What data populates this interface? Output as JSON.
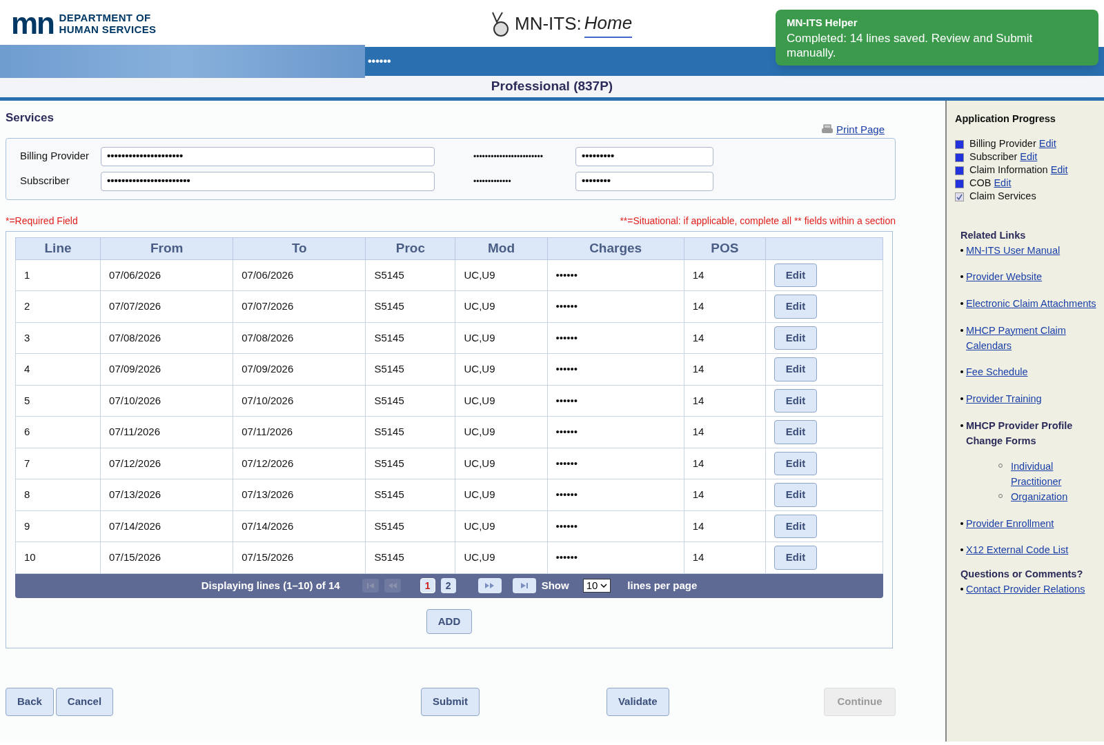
{
  "header": {
    "logo_mark": "mn",
    "logo_lines": [
      "DEPARTMENT OF",
      "HUMAN SERVICES"
    ],
    "app_title": "MN-ITS:",
    "app_subtitle": "Home",
    "masked_user": "••••••"
  },
  "toast": {
    "title": "MN-ITS Helper",
    "message": "Completed: 14 lines saved. Review and Submit manually."
  },
  "page_title": "Professional (837P)",
  "section_title": "Services",
  "print_link": "Print Page",
  "summary": [
    {
      "label": "Billing Provider",
      "value": "•••••••••••••••••••••",
      "label_2": "••••••••••••••••••••••••",
      "value_2": "•••••••••"
    },
    {
      "label": "Subscriber",
      "value": "•••••••••••••••••••••••",
      "label_2": "•••••••••••••",
      "value_2": "••••••••"
    }
  ],
  "required_note": "*=Required Field",
  "situational_note": "**=Situational: if applicable, complete all ** fields within a section",
  "table": {
    "columns": [
      "Line",
      "From",
      "To",
      "Proc",
      "Mod",
      "Charges",
      "POS"
    ],
    "rows": [
      {
        "cells": [
          "1",
          "07/06/2026",
          "07/06/2026",
          "S5145",
          "UC,U9",
          "••••••",
          "14"
        ],
        "action": "Edit"
      },
      {
        "cells": [
          "2",
          "07/07/2026",
          "07/07/2026",
          "S5145",
          "UC,U9",
          "••••••",
          "14"
        ],
        "action": "Edit"
      },
      {
        "cells": [
          "3",
          "07/08/2026",
          "07/08/2026",
          "S5145",
          "UC,U9",
          "••••••",
          "14"
        ],
        "action": "Edit"
      },
      {
        "cells": [
          "4",
          "07/09/2026",
          "07/09/2026",
          "S5145",
          "UC,U9",
          "••••••",
          "14"
        ],
        "action": "Edit"
      },
      {
        "cells": [
          "5",
          "07/10/2026",
          "07/10/2026",
          "S5145",
          "UC,U9",
          "••••••",
          "14"
        ],
        "action": "Edit"
      },
      {
        "cells": [
          "6",
          "07/11/2026",
          "07/11/2026",
          "S5145",
          "UC,U9",
          "••••••",
          "14"
        ],
        "action": "Edit"
      },
      {
        "cells": [
          "7",
          "07/12/2026",
          "07/12/2026",
          "S5145",
          "UC,U9",
          "••••••",
          "14"
        ],
        "action": "Edit"
      },
      {
        "cells": [
          "8",
          "07/13/2026",
          "07/13/2026",
          "S5145",
          "UC,U9",
          "••••••",
          "14"
        ],
        "action": "Edit"
      },
      {
        "cells": [
          "9",
          "07/14/2026",
          "07/14/2026",
          "S5145",
          "UC,U9",
          "••••••",
          "14"
        ],
        "action": "Edit"
      },
      {
        "cells": [
          "10",
          "07/15/2026",
          "07/15/2026",
          "S5145",
          "UC,U9",
          "••••••",
          "14"
        ],
        "action": "Edit"
      }
    ]
  },
  "pager": {
    "status": "Displaying lines (1–10) of 14",
    "first_disabled": true,
    "prev_disabled": true,
    "pages": [
      {
        "label": "1",
        "selected": true
      },
      {
        "label": "2",
        "selected": false
      }
    ],
    "show_label": "Show",
    "per_page": "10",
    "per_page_label": "lines per page"
  },
  "add_button": "ADD",
  "buttons": [
    {
      "label": "Back",
      "disabled": false
    },
    {
      "label": "Cancel",
      "disabled": false
    },
    {
      "label": "Submit",
      "disabled": false
    },
    {
      "label": "Validate",
      "disabled": false
    },
    {
      "label": "Continue",
      "disabled": true
    }
  ],
  "sidebar": {
    "progress_title": "Application Progress",
    "progress": [
      {
        "label": "Billing Provider",
        "edit": "Edit",
        "kind": "square"
      },
      {
        "label": "Subscriber",
        "edit": "Edit",
        "kind": "square"
      },
      {
        "label": "Claim Information",
        "edit": "Edit",
        "kind": "square"
      },
      {
        "label": "COB",
        "edit": "Edit",
        "kind": "square"
      },
      {
        "label": "Claim Services",
        "kind": "check"
      }
    ],
    "links_title": "Related Links",
    "links": [
      {
        "label": "MN-ITS User Manual",
        "kind": "link"
      },
      {
        "label": "Provider Website",
        "kind": "link"
      },
      {
        "label": "Electronic Claim Attachments",
        "kind": "link"
      },
      {
        "label": "MHCP Payment Claim Calendars",
        "kind": "link"
      },
      {
        "label": "Fee Schedule",
        "kind": "link"
      },
      {
        "label": "Provider Training",
        "kind": "link"
      },
      {
        "label": "MHCP Provider Profile Change Forms",
        "kind": "heading",
        "children": [
          {
            "label": "Individual Practitioner"
          },
          {
            "label": "Organization"
          }
        ]
      },
      {
        "label": "Provider Enrollment",
        "kind": "link"
      },
      {
        "label": "X12 External Code List",
        "kind": "link"
      }
    ],
    "questions_title": "Questions or Comments?",
    "questions_links": [
      {
        "label": "Contact Provider Relations"
      }
    ]
  }
}
